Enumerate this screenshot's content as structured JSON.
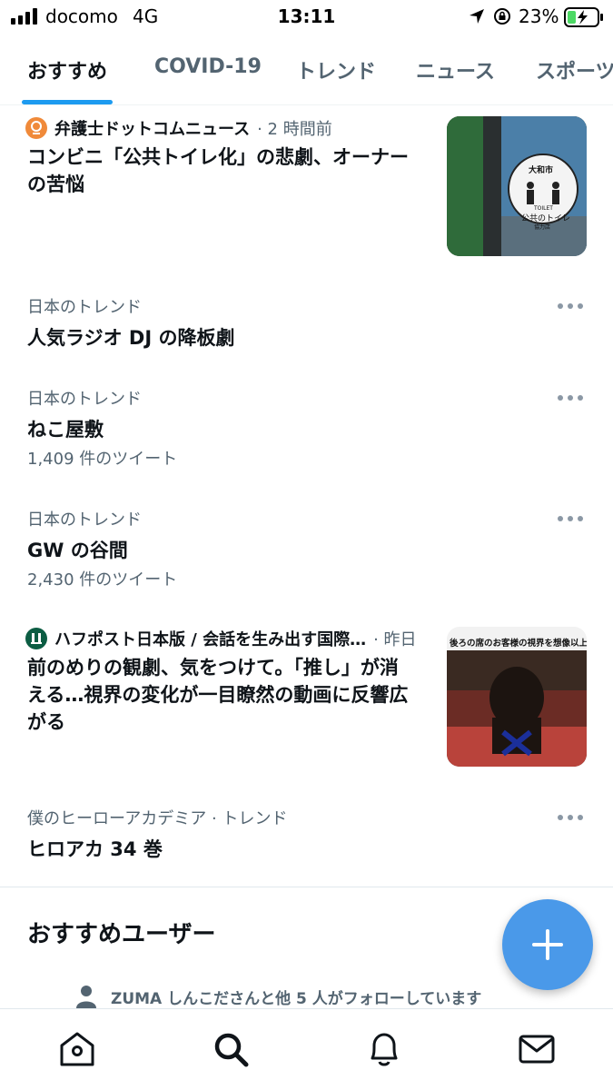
{
  "status_bar": {
    "carrier": "docomo",
    "network": "4G",
    "time": "13:11",
    "battery_percent": "23%",
    "icons": [
      "signal-icon",
      "location-arrow-icon",
      "rotation-lock-icon",
      "battery-charging-icon"
    ]
  },
  "tabs": [
    {
      "label": "おすすめ",
      "active": true
    },
    {
      "label": "COVID-19",
      "active": false
    },
    {
      "label": "トレンド",
      "active": false
    },
    {
      "label": "ニュース",
      "active": false
    },
    {
      "label": "スポーツ",
      "active": false
    }
  ],
  "news": [
    {
      "source": "弁護士ドットコムニュース",
      "time": "· 2 時間前",
      "title_lines": [
        "コンビニ「公共トイレ化」の悲劇、オーナー",
        "の苦悩"
      ],
      "thumb_sign": [
        "大和市",
        "TOILET",
        "公共のトイレ",
        "協力店"
      ]
    },
    {
      "source": "ハフポスト日本版 / 会話を生み出す国際…",
      "time": "· 昨日",
      "title_lines": [
        "前のめりの観劇、気をつけて。「推し」が消",
        "える…視界の変化が一目瞭然の動画に反響広",
        "がる"
      ],
      "thumb_caption": "後ろの席のお客様の視界を想像以上"
    }
  ],
  "trends": [
    {
      "category": "日本のトレンド",
      "title": "人気ラジオ DJ の降板劇",
      "count": ""
    },
    {
      "category": "日本のトレンド",
      "title": "ねこ屋敷",
      "count": "1,409 件のツイート"
    },
    {
      "category": "日本のトレンド",
      "title": "GW の谷間",
      "count": "2,430 件のツイート"
    },
    {
      "category": "僕のヒーローアカデミア · トレンド",
      "title": "ヒロアカ 34 巻",
      "count": ""
    }
  ],
  "recommended": {
    "heading": "おすすめユーザー",
    "follow_text": "ZUMA しんこださんと他 5 人がフォローしています"
  },
  "fab_icon": "plus-icon",
  "bottom_nav": [
    "home-icon",
    "search-icon",
    "notifications-icon",
    "messages-icon"
  ],
  "colors": {
    "accent": "#1d9bf0",
    "fab": "#4a99e9",
    "secondary_text": "#536471"
  }
}
